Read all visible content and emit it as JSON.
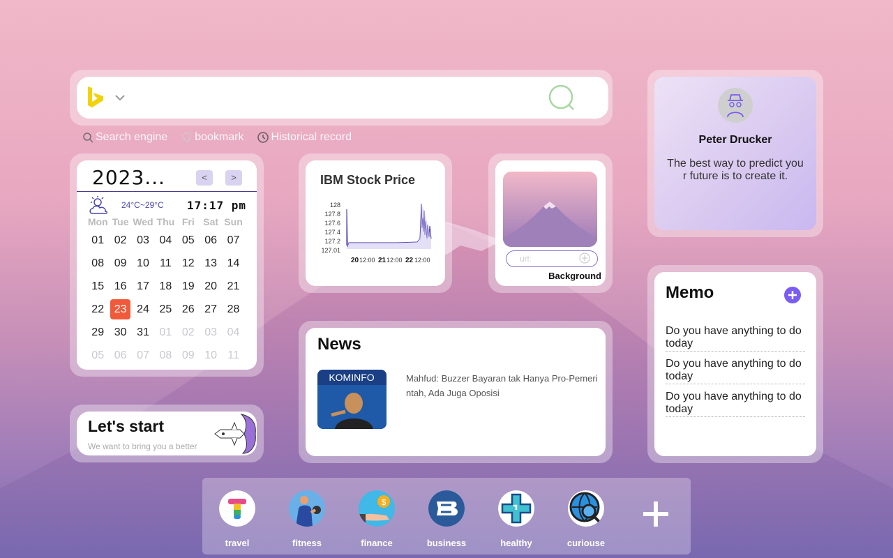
{
  "search": {
    "engine_icon": "bing-logo-icon",
    "placeholder": "",
    "tabs": [
      {
        "label": "Search engine",
        "icon": "search-icon"
      },
      {
        "label": "bookmark",
        "icon": "pin-icon"
      },
      {
        "label": "Historical record",
        "icon": "clock-icon"
      }
    ]
  },
  "calendar": {
    "year": "2023...",
    "prev": "<",
    "next": ">",
    "temp": "24°C~29°C",
    "time": "17:17 pm",
    "weekdays": [
      "Mon",
      "Tue",
      "Wed",
      "Thu",
      "Fri",
      "Sat",
      "Sun"
    ],
    "days": [
      "01",
      "02",
      "03",
      "04",
      "05",
      "06",
      "07",
      "08",
      "09",
      "10",
      "11",
      "12",
      "13",
      "14",
      "15",
      "16",
      "17",
      "18",
      "19",
      "20",
      "21",
      "22",
      "23",
      "24",
      "25",
      "26",
      "27",
      "28",
      "29",
      "30",
      "31",
      "01",
      "02",
      "03",
      "04",
      "05",
      "06",
      "07",
      "08",
      "09",
      "10",
      "11"
    ],
    "today_index": 22,
    "muted_from": 31
  },
  "stock": {
    "title": "IBM Stock Price",
    "y_ticks": [
      "128",
      "127.8",
      "127.6",
      "127.4",
      "127.2",
      "127.01"
    ],
    "x_ticks": [
      "20",
      "12:00",
      "21",
      "12:00",
      "22",
      "12:00"
    ]
  },
  "background": {
    "url_placeholder": "url:",
    "label": "Background"
  },
  "quote": {
    "author": "Peter Drucker",
    "text": "The best way to predict your future is to create it."
  },
  "memo": {
    "title": "Memo",
    "items": [
      "Do you have anything to do today",
      "Do you have anything to do today",
      "Do you have anything to do today"
    ]
  },
  "news": {
    "title": "News",
    "thumb_text": "KOMINFO",
    "headline": "Mahfud: Buzzer Bayaran tak Hanya Pro-Pemerintah, Ada Juga Oposisi"
  },
  "start": {
    "title": "Let's start",
    "subtitle": "We want to bring you a better"
  },
  "dock": {
    "items": [
      {
        "label": "travel",
        "icon": "travel-icon"
      },
      {
        "label": "fitness",
        "icon": "fitness-icon"
      },
      {
        "label": "finance",
        "icon": "finance-icon"
      },
      {
        "label": "business",
        "icon": "business-icon"
      },
      {
        "label": "healthy",
        "icon": "healthy-icon"
      },
      {
        "label": "curiouse",
        "icon": "curiouse-icon"
      }
    ]
  },
  "colors": {
    "accent": "#7b5cf0",
    "today": "#f05a3a",
    "search_icon": "#a8d8a0"
  }
}
